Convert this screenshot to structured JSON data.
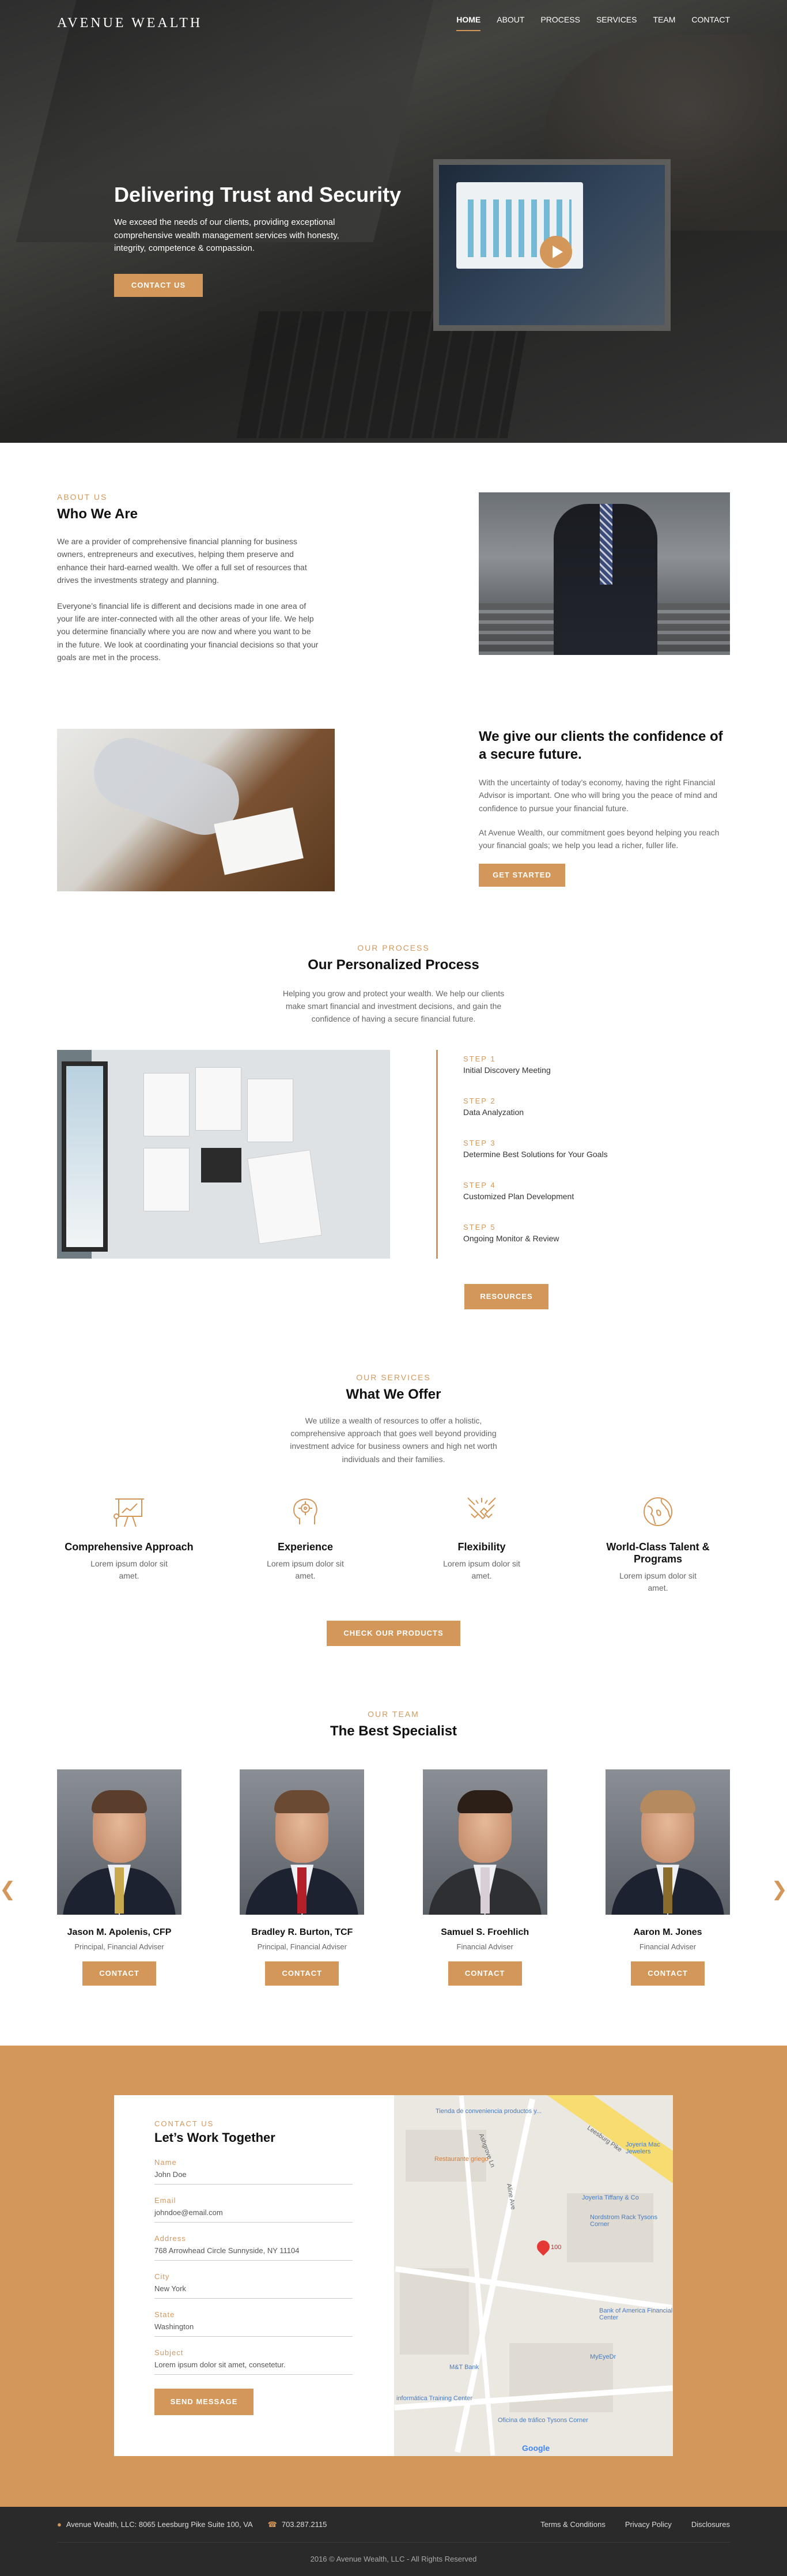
{
  "brand": "AVENUE WEALTH",
  "nav": [
    "HOME",
    "ABOUT",
    "PROCESS",
    "SERVICES",
    "TEAM",
    "CONTACT"
  ],
  "hero": {
    "title": "Delivering Trust and Security",
    "text": "We exceed the needs of our clients, providing exceptional comprehensive wealth management services with honesty, integrity, competence & compassion.",
    "button": "CONTACT US"
  },
  "about": {
    "eyebrow": "ABOUT US",
    "title": "Who We Are",
    "p1": "We are a provider of comprehensive financial planning for business owners, entrepreneurs and executives, helping them preserve and enhance their hard-earned wealth. We offer a full set of resources that drives the investments strategy and planning.",
    "p2": "Everyone’s financial life is different and decisions made in one area of your life are inter-connected with all the other areas of your life. We help you determine financially where you are now and where you want to be in the future. We look at coordinating your financial decisions so that your goals are met in the process."
  },
  "confidence": {
    "title": "We give our clients the confidence of a secure future.",
    "p1": "With the uncertainty of today’s economy, having the right Financial Advisor is important. One who will bring you the peace of mind and confidence to pursue your financial future.",
    "p2": "At Avenue Wealth, our commitment goes beyond helping you reach your financial goals; we help you lead a richer, fuller life.",
    "button": "GET STARTED"
  },
  "process": {
    "eyebrow": "OUR PROCESS",
    "title": "Our Personalized Process",
    "text": "Helping you grow and protect your wealth. We help our clients make smart financial and investment decisions, and gain the confidence of having a secure financial future.",
    "steps": [
      {
        "num": "STEP 1",
        "name": "Initial Discovery Meeting"
      },
      {
        "num": "STEP 2",
        "name": "Data Analyzation"
      },
      {
        "num": "STEP 3",
        "name": "Determine Best Solutions for Your Goals"
      },
      {
        "num": "STEP 4",
        "name": "Customized Plan Development"
      },
      {
        "num": "STEP 5",
        "name": "Ongoing Monitor & Review"
      }
    ],
    "button": "RESOURCES"
  },
  "services": {
    "eyebrow": "OUR SERVICES",
    "title": "What We Offer",
    "text": "We utilize a wealth of resources to offer a holistic, comprehensive approach that goes well beyond providing investment advice for business owners and high net worth individuals and their families.",
    "items": [
      {
        "title": "Comprehensive Approach",
        "desc": "Lorem ipsum dolor sit amet.",
        "icon": "presentation-icon"
      },
      {
        "title": "Experience",
        "desc": "Lorem ipsum dolor sit amet.",
        "icon": "brain-gear-icon"
      },
      {
        "title": "Flexibility",
        "desc": "Lorem ipsum dolor sit amet.",
        "icon": "handshake-icon"
      },
      {
        "title": "World-Class Talent & Programs",
        "desc": "Lorem ipsum dolor sit amet.",
        "icon": "globe-icon"
      }
    ],
    "button": "CHECK OUR PRODUCTS"
  },
  "team": {
    "eyebrow": "OUR TEAM",
    "title": "The Best Specialist",
    "members": [
      {
        "name": "Jason M. Apolenis, CFP",
        "role": "Principal, Financial Adviser",
        "button": "CONTACT"
      },
      {
        "name": "Bradley R. Burton, TCF",
        "role": "Principal, Financial Adviser",
        "button": "CONTACT"
      },
      {
        "name": "Samuel S. Froehlich",
        "role": "Financial Adviser",
        "button": "CONTACT"
      },
      {
        "name": "Aaron M. Jones",
        "role": "Financial Adviser",
        "button": "CONTACT"
      }
    ]
  },
  "contact": {
    "eyebrow": "CONTACT US",
    "title": "Let’s Work Together",
    "fields": [
      {
        "label": "Name",
        "value": "John Doe"
      },
      {
        "label": "Email",
        "value": "johndoe@email.com"
      },
      {
        "label": "Address",
        "value": "768 Arrowhead Circle Sunnyside, NY 11104"
      },
      {
        "label": "City",
        "value": "New York"
      },
      {
        "label": "State",
        "value": "Washington"
      },
      {
        "label": "Subject",
        "value": "Lorem ipsum dolor sit amet, consetetur."
      }
    ],
    "button": "SEND MESSAGE"
  },
  "map": {
    "pois": [
      "Tienda de conveniencia productos y...",
      "Restaurante griego",
      "Joyería Mac Jewelers",
      "Joyería Tiffany & Co",
      "Nordstrom Rack Tysons Corner",
      "Bank of America Financial Center",
      "MyEyeDr",
      "M&T Bank",
      "informática Training Center",
      "Oficina de tráfico Tysons Corner",
      "Leesburg Pike",
      "Aline Ave",
      "Ashgrove Ln"
    ],
    "pin_label": "100",
    "google": "Google"
  },
  "footer": {
    "address": "Avenue Wealth, LLC: 8065 Leesburg Pike Suite 100, VA",
    "phone": "703.287.2115",
    "links": [
      "Terms & Conditions",
      "Privacy Policy",
      "Disclosures"
    ],
    "copyright": "2016 © Avenue Wealth, LLC - All Rights Reserved"
  },
  "colors": {
    "accent": "#d4975a",
    "footer": "#2a2a2a"
  }
}
